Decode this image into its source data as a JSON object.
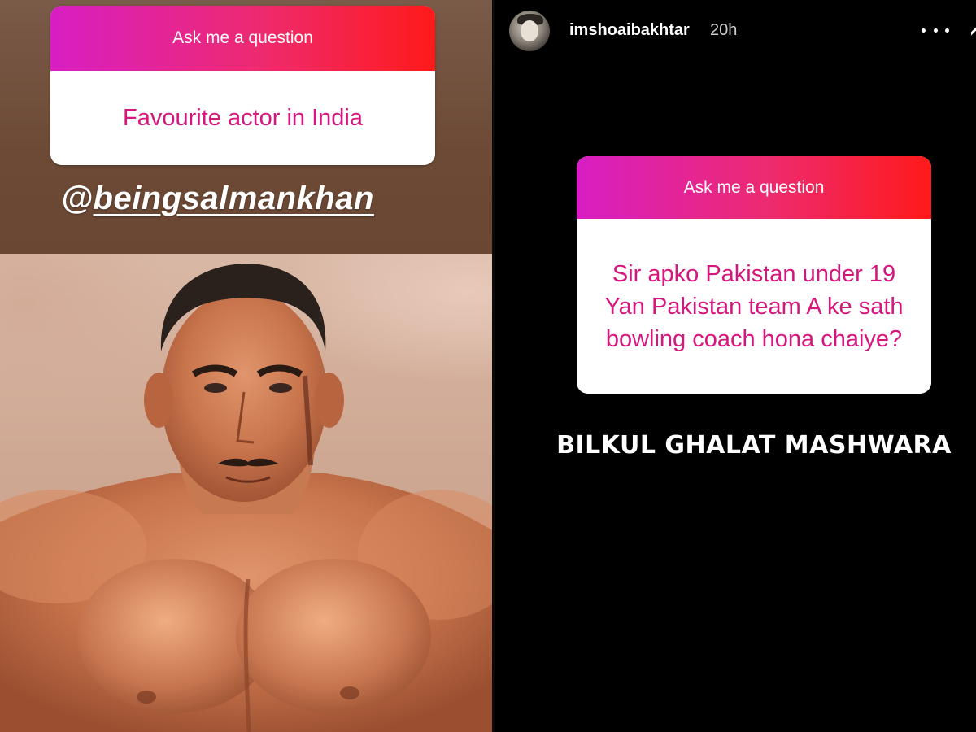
{
  "left_story": {
    "question_card": {
      "header": "Ask me a question",
      "question": "Favourite  actor in India"
    },
    "mention": {
      "at": "@",
      "handle": "beingsalmankhan"
    }
  },
  "right_story": {
    "header": {
      "username": "imshoaibakhtar",
      "timestamp": "20h"
    },
    "question_card": {
      "header": "Ask me a question",
      "question": "Sir apko Pakistan under 19 Yan Pakistan team A ke sath bowling coach hona chaiye?"
    },
    "answer": "BILKUL GHALAT MASHWARA"
  },
  "colors": {
    "card_gradient_start": "#d81ec4",
    "card_gradient_mid": "#ee2a6e",
    "card_gradient_end": "#ff1a1a",
    "question_text": "#d6167c",
    "left_background": "#6e4a35",
    "right_background": "#000000"
  },
  "icons": {
    "more": "more-horizontal-icon",
    "close": "close-icon"
  }
}
